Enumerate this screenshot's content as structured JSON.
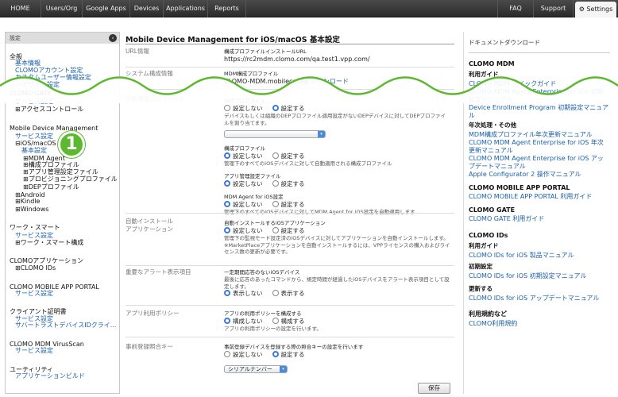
{
  "topnav": {
    "items": [
      "HOME",
      "Users/Org",
      "Google Apps",
      "Devices",
      "Applications",
      "Reports"
    ],
    "faq": "FAQ",
    "support": "Support",
    "settings": "Settings"
  },
  "sidebar": {
    "header": "設定",
    "collapse_icon": "chevron-left-icon",
    "items": [
      {
        "text": "全般",
        "kind": "h"
      },
      {
        "text": "基本情報",
        "kind": "l"
      },
      {
        "text": "CLOMOアカウント設定",
        "kind": "l"
      },
      {
        "text": "カスタムユーザー情報設定",
        "kind": "l"
      },
      {
        "text": "ジオサイト設定",
        "kind": "l"
      },
      {
        "text": "CLOMO GATE",
        "kind": "h"
      },
      {
        "text": "サービス設定",
        "kind": "l"
      },
      {
        "text": "⊞アクセスコントロール",
        "kind": "d"
      },
      {
        "text": "Mobile Device Management",
        "kind": "h"
      },
      {
        "text": "サービス設定",
        "kind": "l"
      },
      {
        "text": "⊟iOS/macOS",
        "kind": "d"
      },
      {
        "text": "基本設定",
        "kind": "l"
      },
      {
        "text": "⊞MDM Agent",
        "kind": "d"
      },
      {
        "text": "⊞構成プロファイル",
        "kind": "d"
      },
      {
        "text": "⊞アプリ管理設定ファイル",
        "kind": "d"
      },
      {
        "text": "⊞プロビジョニングプロファイル",
        "kind": "d"
      },
      {
        "text": "⊞DEPプロファイル",
        "kind": "d"
      },
      {
        "text": "⊞Android",
        "kind": "d"
      },
      {
        "text": "⊞Kindle",
        "kind": "d"
      },
      {
        "text": "⊞Windows",
        "kind": "d"
      },
      {
        "text": "ワーク・スマート",
        "kind": "h"
      },
      {
        "text": "サービス設定",
        "kind": "l"
      },
      {
        "text": "⊞ワーク・スマート構成",
        "kind": "d"
      },
      {
        "text": "CLOMOアプリケーション",
        "kind": "h"
      },
      {
        "text": "⊞CLOMO IDs",
        "kind": "d"
      },
      {
        "text": "CLOMO MOBILE APP PORTAL",
        "kind": "h"
      },
      {
        "text": "サービス設定",
        "kind": "l"
      },
      {
        "text": "クライアント証明書",
        "kind": "h"
      },
      {
        "text": "サービス設定",
        "kind": "l"
      },
      {
        "text": "サバートラストデバイスIDクライ...",
        "kind": "l"
      },
      {
        "text": "CLOMO MDM VirusScan",
        "kind": "h"
      },
      {
        "text": "サービス設定",
        "kind": "l"
      },
      {
        "text": "ユーティリティ",
        "kind": "h"
      },
      {
        "text": "アプリケーションビルド",
        "kind": "l"
      }
    ]
  },
  "callout": "1",
  "main": {
    "title": "Mobile Device Management for iOS/macOS 基本設定",
    "url_info": {
      "label": "URL情報",
      "sub": "構成プロファイルインストールURL",
      "value": "https://rc2mdm.clomo.com/qa.test1.vpp.com/"
    },
    "sys_info": {
      "label": "システム構成情報",
      "sub": "MDM構成プロファイル",
      "file": "CLOMO-MDM.mobileconfig",
      "download": "ダウンロード"
    },
    "auto_profile": {
      "label": "自動適用プロファイル",
      "dep_title": "DEPプロファイル",
      "dep_no": "設定しない",
      "dep_yes": "設定する",
      "dep_note": "デバイスもしくは組織のDEPプロファイル適用設定がないDEPデバイスに対してDEPプロファイルを割り当てます。",
      "cfg_title": "構成プロファイル",
      "cfg_no": "設定しない",
      "cfg_yes": "設定する",
      "cfg_note": "管理下のすべてのiOSデバイスに対して自動適用される構成プロファイル",
      "app_title": "アプリ管理設定ファイル",
      "app_no": "設定しない",
      "app_yes": "設定する",
      "agent_title": "MDM Agent for iOS設定",
      "agent_no": "設定しない",
      "agent_yes": "設定する",
      "agent_note": "管理下のすべてのiOSデバイスに対してMDM Agent for iOS設定を自動適用します"
    },
    "auto_install": {
      "label1": "自動インストール",
      "label2": "アプリケーション",
      "sub": "自動インストールするiOSアプリケーション",
      "no": "設定しない",
      "yes": "設定する",
      "note1": "管理下の監視モード設定済のiOSデバイスに対してアプリケーションを自動インストールします。",
      "note2": "※MarketPlaceアプリケーションを自動インストールするには、VPPライセンスの購入およびライセンス数の更新が必要です。"
    },
    "alert": {
      "label": "重要なアラート表示項目",
      "sub": "一定期間応答のないiOSデバイス",
      "note": "最後に応答のあったコマンドから、規定時間が経過したiOSデバイスをアラート表示項目として設定します。",
      "no": "表示しない",
      "yes": "表示する"
    },
    "policy": {
      "label": "アプリ利用ポリシー",
      "sub": "アプリの利用ポリシーを構成する",
      "no": "構成しない",
      "yes": "構成する",
      "note": "アプリの利用ポリシーの設定を行います。"
    },
    "prereg": {
      "label": "事前登録照合キー",
      "sub": "事前登録デバイスを登録する際の照合キーの設定を行います",
      "no": "設定しない",
      "yes": "設定する",
      "select": "シリアルナンバー"
    },
    "save": "保存"
  },
  "right": {
    "title": "ドキュメントダウンロード",
    "sections": [
      {
        "text": "CLOMO MDM",
        "kind": "h2"
      },
      {
        "text": "利用ガイド",
        "kind": "h3"
      },
      {
        "text": "CLOMO MDM クイックガイド",
        "kind": "lk"
      },
      {
        "text": "CLOMO MDM Agent Enterprise for iOS 初期",
        "kind": "lk"
      },
      {
        "text": "設定マニュアル",
        "kind": "lk"
      },
      {
        "text": "Device Enrollment Program 初期設定マニュア",
        "kind": "lk"
      },
      {
        "text": "ル",
        "kind": "lk"
      },
      {
        "text": "年次処理・その他",
        "kind": "h3"
      },
      {
        "text": "MDM構成プロファイル年次更新マニュアル",
        "kind": "lk"
      },
      {
        "text": "CLOMO MDM Agent Enterprise for iOS 年次",
        "kind": "lk"
      },
      {
        "text": "更新マニュアル",
        "kind": "lk"
      },
      {
        "text": "CLOMO MDM Agent Enterprise for iOS アッ",
        "kind": "lk"
      },
      {
        "text": "プデートマニュアル",
        "kind": "lk"
      },
      {
        "text": "Apple Configurator 2 操作マニュアル",
        "kind": "lk"
      },
      {
        "text": "CLOMO MOBILE APP PORTAL",
        "kind": "h2"
      },
      {
        "text": "CLOMO MOBILE APP PORTAL 利用ガイド",
        "kind": "lk"
      },
      {
        "text": "CLOMO GATE",
        "kind": "h2"
      },
      {
        "text": "CLOMO GATE 利用ガイド",
        "kind": "lk"
      },
      {
        "text": "CLOMO IDs",
        "kind": "h2"
      },
      {
        "text": "利用ガイド",
        "kind": "h3"
      },
      {
        "text": "CLOMO IDs for iOS 製品マニュアル",
        "kind": "lk"
      },
      {
        "text": "初期設定",
        "kind": "h3"
      },
      {
        "text": "CLOMO IDs for iOS 初期設定マニュアル",
        "kind": "lk"
      },
      {
        "text": "更新する",
        "kind": "h3"
      },
      {
        "text": "CLOMO IDs for iOS アップデートマニュアル",
        "kind": "lk"
      },
      {
        "text": "利用規約など",
        "kind": "h2"
      },
      {
        "text": "CLOMO利用規約",
        "kind": "lk"
      }
    ]
  },
  "colors": {
    "accent": "#5cb82e",
    "link": "#1a5fa8",
    "radio": "#3a7bd5"
  }
}
